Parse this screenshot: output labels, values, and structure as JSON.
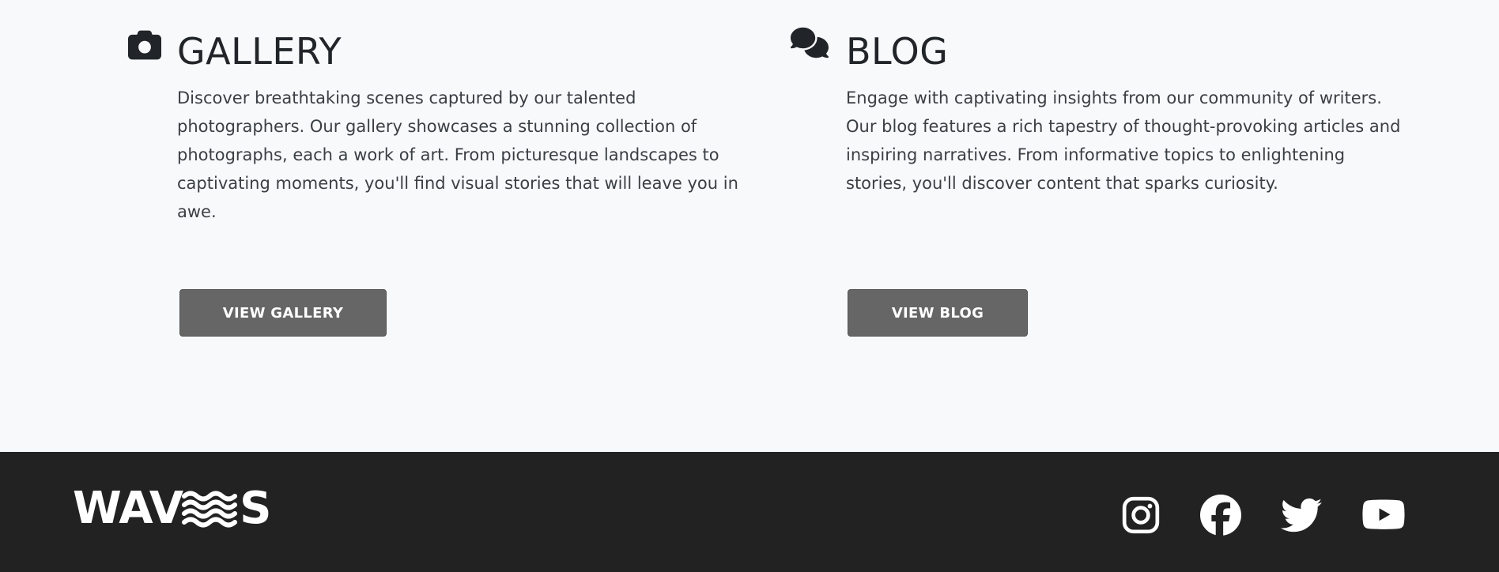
{
  "sections": {
    "gallery": {
      "icon": "camera-icon",
      "title": "GALLERY",
      "text": "Discover breathtaking scenes captured by our talented photographers. Our gallery showcases a stunning collection of photographs, each a work of art. From picturesque landscapes to captivating moments, you'll find visual stories that will leave you in awe.",
      "button_label": "VIEW GALLERY"
    },
    "blog": {
      "icon": "comments-icon",
      "title": "BLOG",
      "text": "Engage with captivating insights from our community of writers. Our blog features a rich tapestry of thought-provoking articles and inspiring narratives. From informative topics to enlightening stories, you'll discover content that sparks curiosity.",
      "button_label": "VIEW BLOG"
    }
  },
  "footer": {
    "logo_text_start": "WAV",
    "logo_text_end": "S",
    "logo_mark": "waves-icon",
    "social": [
      "instagram-icon",
      "facebook-icon",
      "twitter-icon",
      "youtube-icon"
    ]
  },
  "colors": {
    "page_bg": "#f8f9fa",
    "text": "#212529",
    "button_bg": "#666666",
    "footer_bg": "#222222",
    "footer_fg": "#ffffff"
  }
}
